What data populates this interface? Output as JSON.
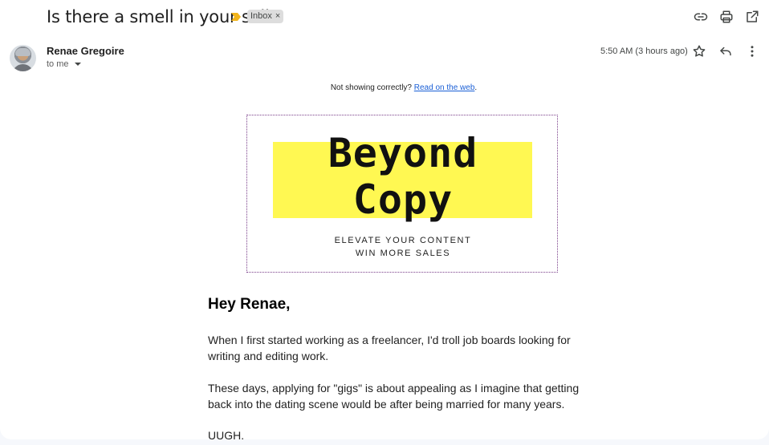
{
  "email": {
    "subject": "Is there a smell in your sell?",
    "label": "Inbox",
    "label_remove": "×",
    "sender": "Renae Gregoire",
    "recipient": "to me",
    "timestamp": "5:50 AM (3 hours ago)"
  },
  "icons": {
    "importance": "importance-marker-icon",
    "link": "link-icon",
    "print": "print-icon",
    "open_new": "open-in-new-window-icon",
    "star": "star-icon",
    "reply": "reply-icon",
    "more": "more-vert-icon",
    "caret": "chevron-down-icon"
  },
  "colors": {
    "importance": "#f2b51c",
    "banner_yellow": "#fff852",
    "link": "#1a5fd6"
  },
  "body": {
    "notice_text": "Not showing correctly?",
    "notice_link": "Read on the web",
    "notice_period": ".",
    "banner": {
      "logo_line1": "Beyond",
      "logo_line2": "Copy",
      "tagline1": "ELEVATE YOUR CONTENT",
      "tagline2": "WIN MORE SALES"
    },
    "greeting": "Hey Renae,",
    "paragraphs": [
      "When I first started working as a freelancer, I'd troll job boards looking for writing and editing work.",
      "These days, applying for \"gigs\" is about appealing as I imagine that getting back into the dating scene would be after being married for many years.",
      "UUGH."
    ]
  }
}
